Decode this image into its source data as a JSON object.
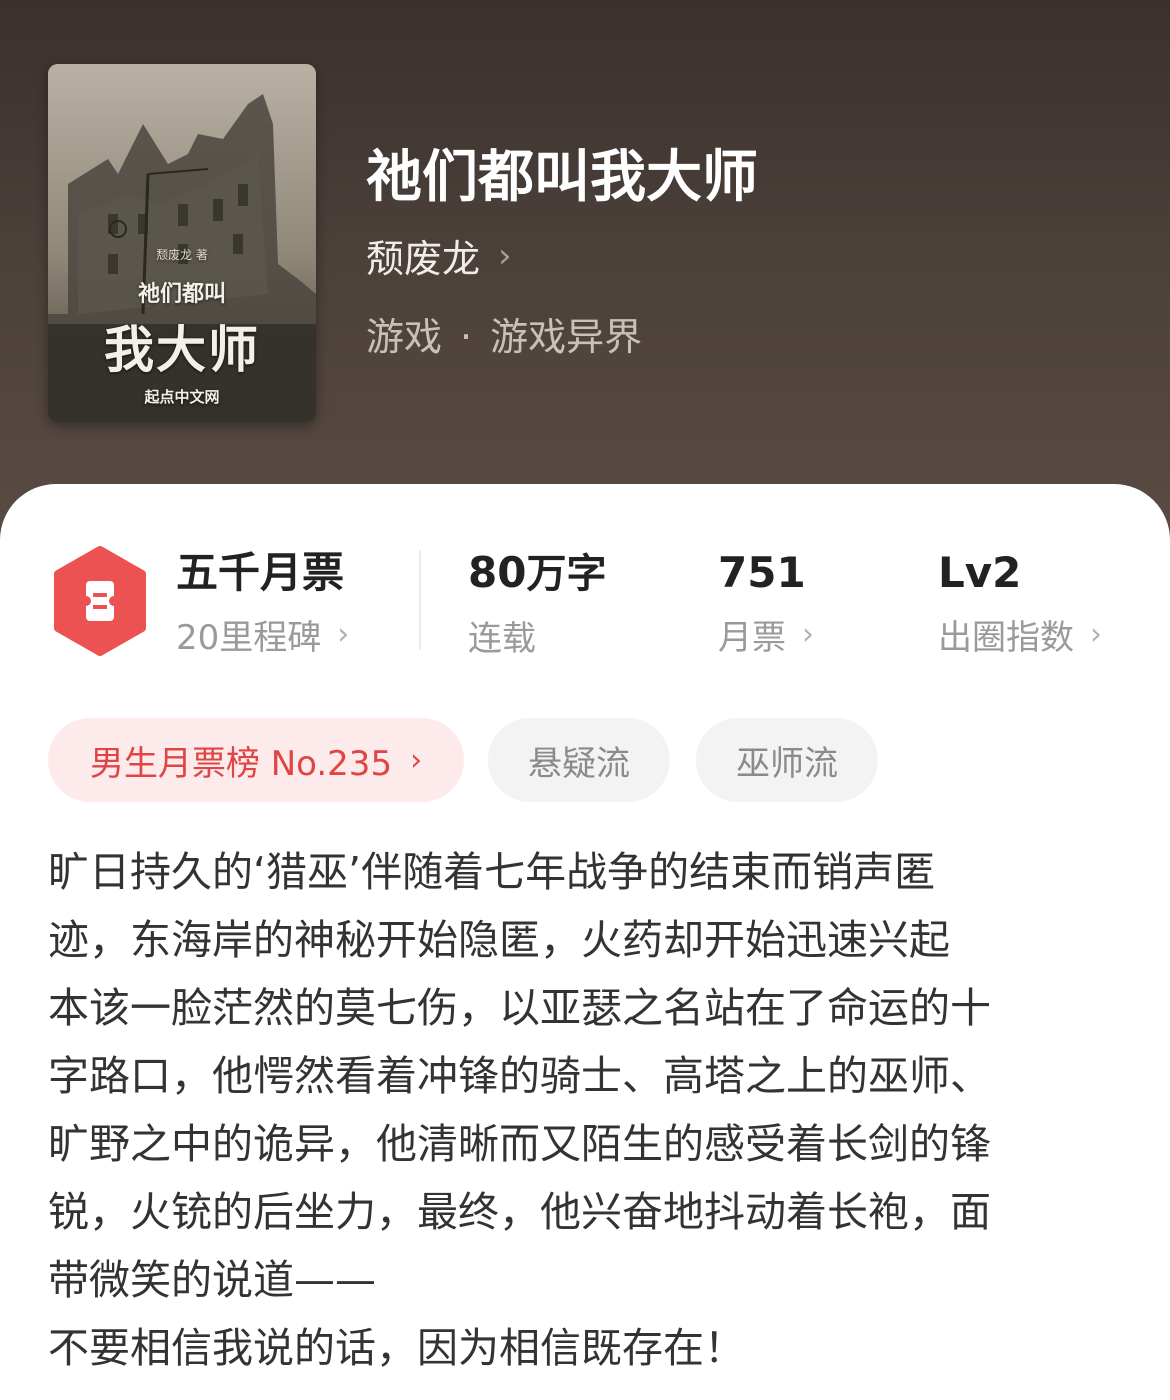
{
  "book": {
    "title": "祂们都叫我大师",
    "author": "颓废龙",
    "category": "游戏",
    "subcategory": "游戏异界",
    "separator": "·"
  },
  "cover": {
    "author_text": "颓废龙 著",
    "title_line1": "祂们都叫",
    "title_line2": "我大师",
    "publisher": "起点中文网"
  },
  "stats": {
    "milestone": {
      "value": "五千月票",
      "label": "20里程碑"
    },
    "words": {
      "value": "80",
      "unit": "万字",
      "label": "连载"
    },
    "monthly_votes": {
      "value": "751",
      "label": "月票"
    },
    "influence": {
      "value": "Lv2",
      "label": "出圈指数"
    }
  },
  "tags": {
    "rank": "男生月票榜 No.235",
    "tag1": "悬疑流",
    "tag2": "巫师流"
  },
  "description": [
    "旷日持久的‘猎巫’伴随着七年战争的结束而销声匿",
    "迹，东海岸的神秘开始隐匿，火药却开始迅速兴起",
    "本该一脸茫然的莫七伤，以亚瑟之名站在了命运的十",
    "字路口，他愕然看着冲锋的骑士、高塔之上的巫师、",
    "旷野之中的诡异，他清晰而又陌生的感受着长剑的锋",
    "锐，火铳的后坐力，最终，他兴奋地抖动着长袍，面",
    "带微笑的说道——",
    "不要相信我说的话，因为相信既存在！"
  ],
  "colors": {
    "hero_bg": "#4b403a",
    "accent_red": "#e04545",
    "rank_tag_bg": "#fdeaea"
  },
  "icons": {
    "chevron": "chevron-right-icon",
    "ticket_badge": "ticket-badge-icon"
  }
}
